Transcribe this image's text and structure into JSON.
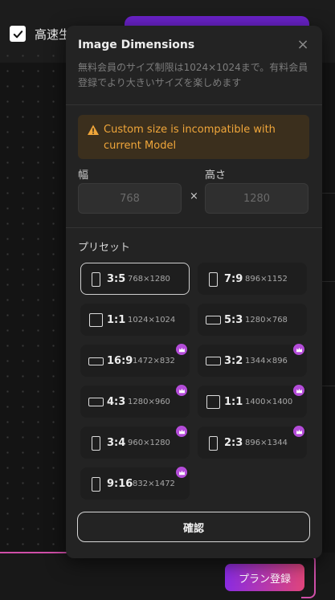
{
  "background": {
    "high_quality_label": "高速生",
    "plan_button_label": "プラン登録"
  },
  "modal": {
    "title": "Image Dimensions",
    "close_glyph": "×",
    "description": "無料会員のサイズ制限は1024×1024まで。有料会員登録でより大きいサイズを楽しめます",
    "warning": "Custom size is incompatible with current Model",
    "width_label": "幅",
    "height_label": "高さ",
    "width_value": "768",
    "height_value": "1280",
    "times_glyph": "×",
    "preset_title": "プリセット",
    "confirm_label": "確認"
  },
  "presets": [
    {
      "ratio": "3:5",
      "size": "768×1280",
      "orientation": "portrait",
      "premium": false,
      "selected": true
    },
    {
      "ratio": "7:9",
      "size": "896×1152",
      "orientation": "portrait",
      "premium": false,
      "selected": false
    },
    {
      "ratio": "1:1",
      "size": "1024×1024",
      "orientation": "square",
      "premium": false,
      "selected": false
    },
    {
      "ratio": "5:3",
      "size": "1280×768",
      "orientation": "landscape",
      "premium": false,
      "selected": false
    },
    {
      "ratio": "16:9",
      "size": "1472×832",
      "orientation": "landscape",
      "premium": true,
      "selected": false
    },
    {
      "ratio": "3:2",
      "size": "1344×896",
      "orientation": "landscape",
      "premium": true,
      "selected": false
    },
    {
      "ratio": "4:3",
      "size": "1280×960",
      "orientation": "landscape",
      "premium": true,
      "selected": false
    },
    {
      "ratio": "1:1",
      "size": "1400×1400",
      "orientation": "square",
      "premium": true,
      "selected": false
    },
    {
      "ratio": "3:4",
      "size": "960×1280",
      "orientation": "portrait",
      "premium": true,
      "selected": false
    },
    {
      "ratio": "2:3",
      "size": "896×1344",
      "orientation": "portrait",
      "premium": true,
      "selected": false
    },
    {
      "ratio": "9:16",
      "size": "832×1472",
      "orientation": "portrait",
      "premium": true,
      "selected": false
    }
  ],
  "colors": {
    "accent_purple": "#6a22c9",
    "warning_text": "#f0a63a",
    "crown_badge": "#b44cd9"
  }
}
